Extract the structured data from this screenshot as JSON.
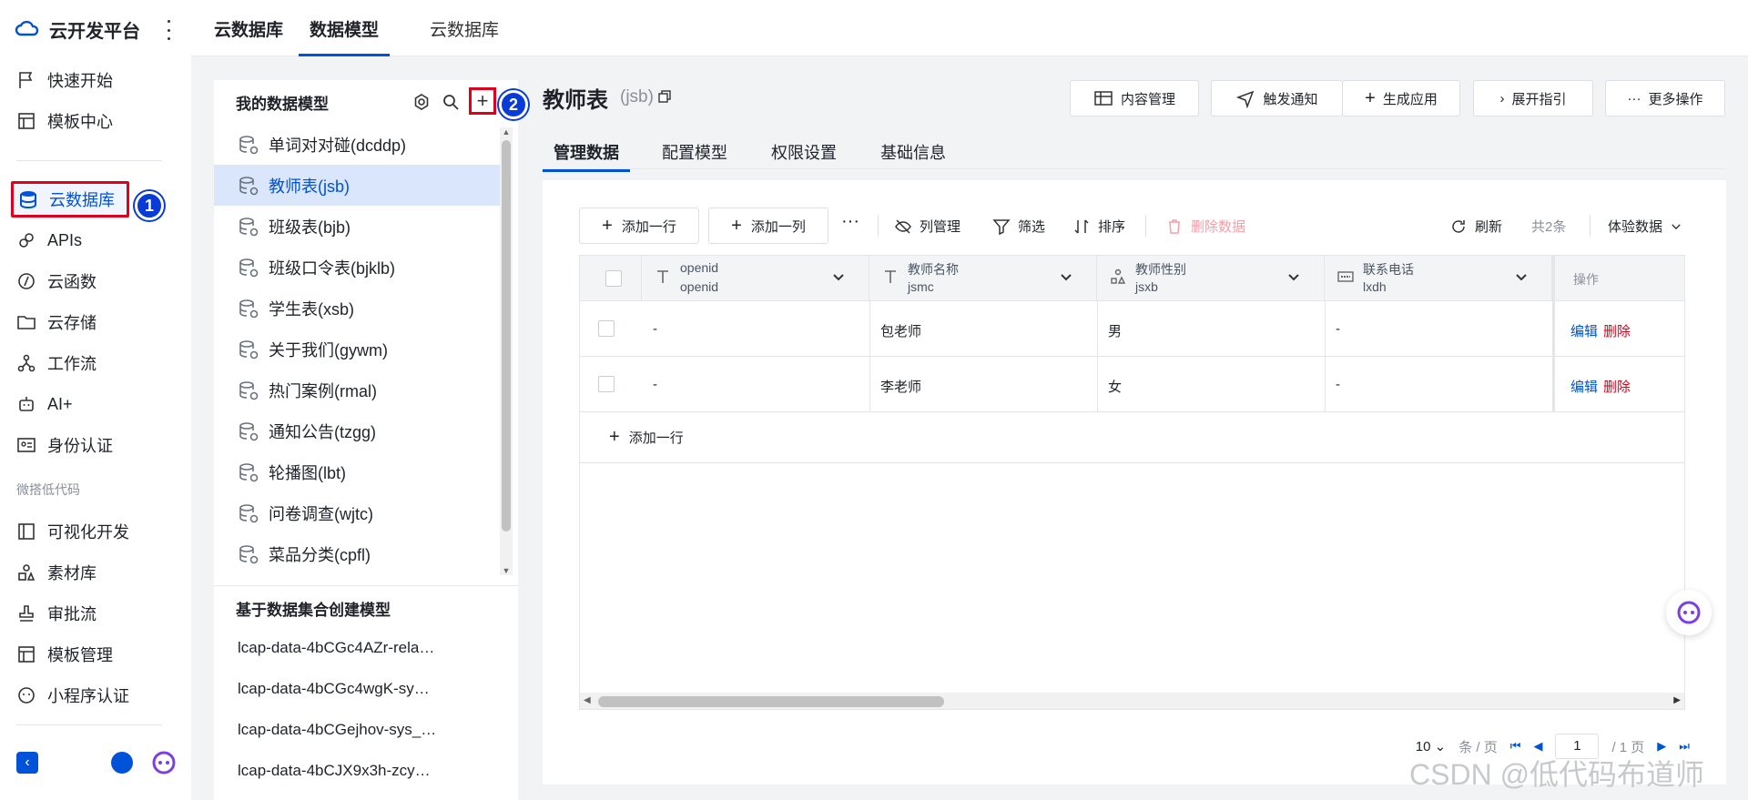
{
  "sidebar": {
    "brand": "云开发平台",
    "items": [
      {
        "label": "快速开始",
        "icon": "flag-icon"
      },
      {
        "label": "模板中心",
        "icon": "template-icon"
      },
      {
        "label": "云数据库",
        "icon": "database-icon",
        "active": true
      },
      {
        "label": "APIs",
        "icon": "link-icon"
      },
      {
        "label": "云函数",
        "icon": "function-icon"
      },
      {
        "label": "云存储",
        "icon": "folder-icon"
      },
      {
        "label": "工作流",
        "icon": "workflow-icon"
      },
      {
        "label": "AI+",
        "icon": "robot-icon"
      },
      {
        "label": "身份认证",
        "icon": "id-card-icon"
      }
    ],
    "group_label": "微搭低代码",
    "items2": [
      {
        "label": "可视化开发",
        "icon": "layout-icon"
      },
      {
        "label": "素材库",
        "icon": "shapes-icon"
      },
      {
        "label": "审批流",
        "icon": "stamp-icon"
      },
      {
        "label": "模板管理",
        "icon": "template-icon"
      },
      {
        "label": "小程序认证",
        "icon": "smile-icon"
      }
    ],
    "badge1": "1"
  },
  "topbar": {
    "tabs": [
      "云数据库",
      "数据模型",
      "云数据库"
    ]
  },
  "panel": {
    "title": "我的数据模型",
    "badge2": "2",
    "models": [
      "单词对对碰(dcddp)",
      "教师表(jsb)",
      "班级表(bjb)",
      "班级口令表(bjklb)",
      "学生表(xsb)",
      "关于我们(gywm)",
      "热门案例(rmal)",
      "通知公告(tzgg)",
      "轮播图(lbt)",
      "问卷调查(wjtc)",
      "菜品分类(cpfl)"
    ],
    "selected_index": 1,
    "dataset_title": "基于数据集合创建模型",
    "datasets": [
      "lcap-data-4bCGc4AZr-rela…",
      "lcap-data-4bCGc4wgK-sy…",
      "lcap-data-4bCGejhov-sys_…",
      "lcap-data-4bCJX9x3h-zcy…"
    ]
  },
  "main": {
    "title": "教师表",
    "subtitle": "(jsb)",
    "actions": [
      "内容管理",
      "触发通知",
      "生成应用",
      "展开指引",
      "更多操作"
    ],
    "tabs": [
      "管理数据",
      "配置模型",
      "权限设置",
      "基础信息"
    ],
    "toolbar": {
      "add_row": "添加一行",
      "add_col": "添加一列",
      "columns": "列管理",
      "filter": "筛选",
      "sort": "排序",
      "delete": "删除数据",
      "refresh": "刷新",
      "count": "共2条",
      "env": "体验数据"
    },
    "columns": [
      {
        "name": "openid",
        "key": "openid",
        "icon": "text-type-icon"
      },
      {
        "name": "教师名称",
        "key": "jsmc",
        "icon": "text-type-icon"
      },
      {
        "name": "教师性别",
        "key": "jsxb",
        "icon": "enum-type-icon"
      },
      {
        "name": "联系电话",
        "key": "lxdh",
        "icon": "phone-type-icon"
      }
    ],
    "op_header": "操作",
    "rows": [
      {
        "openid": "-",
        "jsmc": "包老师",
        "jsxb": "男",
        "lxdh": "-"
      },
      {
        "openid": "-",
        "jsmc": "李老师",
        "jsxb": "女",
        "lxdh": "-"
      }
    ],
    "op_edit": "编辑",
    "op_delete": "删除",
    "add_row_footer": "添加一行",
    "pager": {
      "page_size": "10",
      "per_page": "条 / 页",
      "current": "1",
      "total": "/ 1 页"
    }
  },
  "watermark": "CSDN @低代码布道师"
}
